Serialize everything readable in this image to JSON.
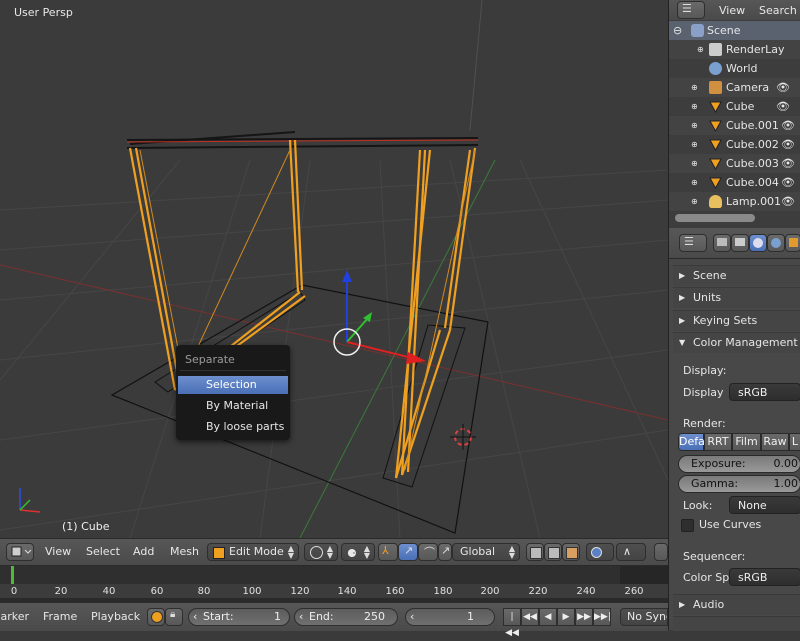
{
  "viewport": {
    "title": "User Persp",
    "object_label": "(1) Cube"
  },
  "context_menu": {
    "title": "Separate",
    "items": [
      {
        "label": "Selection",
        "active": true
      },
      {
        "label": "By Material",
        "active": false
      },
      {
        "label": "By loose parts",
        "active": false
      }
    ]
  },
  "view3d_header": {
    "menus": [
      "View",
      "Select",
      "Add",
      "Mesh"
    ],
    "mode": "Edit Mode",
    "orientation": "Global"
  },
  "timeline": {
    "ticks": [
      "0",
      "20",
      "40",
      "60",
      "80",
      "100",
      "120",
      "140",
      "160",
      "180",
      "200",
      "220",
      "240",
      "260"
    ],
    "current_frame": 1
  },
  "timeline_header": {
    "menus": [
      "Marker",
      "Frame",
      "Playback"
    ],
    "start_label": "Start:",
    "start_value": "1",
    "end_label": "End:",
    "end_value": "250",
    "current_value": "1",
    "sync": "No Sync"
  },
  "outliner": {
    "header_menus": [
      "View",
      "Search"
    ],
    "items": [
      {
        "label": "Scene",
        "icon": "scene-icon",
        "indent": 0
      },
      {
        "label": "RenderLay",
        "icon": "render-layers-icon",
        "indent": 1
      },
      {
        "label": "World",
        "icon": "world-icon",
        "indent": 1
      },
      {
        "label": "Camera",
        "icon": "camera-icon",
        "indent": 1
      },
      {
        "label": "Cube",
        "icon": "mesh-icon",
        "indent": 1
      },
      {
        "label": "Cube.001",
        "icon": "mesh-icon",
        "indent": 1
      },
      {
        "label": "Cube.002",
        "icon": "mesh-icon",
        "indent": 1
      },
      {
        "label": "Cube.003",
        "icon": "mesh-icon",
        "indent": 1
      },
      {
        "label": "Cube.004",
        "icon": "mesh-icon",
        "indent": 1
      },
      {
        "label": "Lamp.001",
        "icon": "lamp-icon",
        "indent": 1
      }
    ]
  },
  "properties": {
    "panels": {
      "scene": "Scene",
      "units": "Units",
      "keying_sets": "Keying Sets",
      "color_management": "Color Management",
      "audio": "Audio"
    },
    "display_section": "Display:",
    "display_label": "Display",
    "display_value": "sRGB",
    "render_section": "Render:",
    "render_tabs": [
      "Defa",
      "RRT",
      "Film",
      "Raw",
      "L"
    ],
    "exposure_label": "Exposure:",
    "exposure_value": "0.00",
    "gamma_label": "Gamma:",
    "gamma_value": "1.00",
    "look_label": "Look:",
    "look_value": "None",
    "use_curves": "Use Curves",
    "sequencer_section": "Sequencer:",
    "color_space_label": "Color Sp",
    "color_space_value": "sRGB"
  },
  "colors": {
    "accent_blue": "#5b80c6",
    "wire_orange": "#f0a020",
    "frame_green": "#4fba3a"
  }
}
